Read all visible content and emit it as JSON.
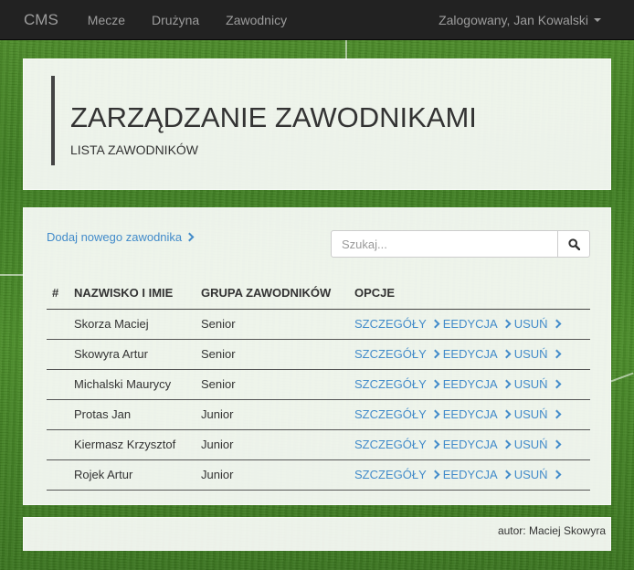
{
  "navbar": {
    "brand": "CMS",
    "links": [
      "Mecze",
      "Drużyna",
      "Zawodnicy"
    ],
    "user": "Zalogowany, Jan Kowalski"
  },
  "header": {
    "title": "ZARZĄDZANIE ZAWODNIKAMI",
    "subtitle": "LISTA ZAWODNIKÓW"
  },
  "content": {
    "add_link": "Dodaj nowego zawodnika",
    "search_placeholder": "Szukaj...",
    "columns": [
      "#",
      "NAZWISKO I IMIE",
      "GRUPA ZAWODNIKÓW",
      "OPCJE"
    ],
    "options": [
      "SZCZEGÓŁY",
      "EEDYCJA",
      "USUŃ"
    ],
    "rows": [
      {
        "name": "Skorza Maciej",
        "group": "Senior"
      },
      {
        "name": "Skowyra Artur",
        "group": "Senior"
      },
      {
        "name": "Michalski Maurycy",
        "group": "Senior"
      },
      {
        "name": "Protas Jan",
        "group": "Junior"
      },
      {
        "name": "Kiermasz Krzysztof",
        "group": "Junior"
      },
      {
        "name": "Rojek Artur",
        "group": "Junior"
      }
    ]
  },
  "footer": {
    "author": "autor: Maciej Skowyra"
  },
  "colors": {
    "link": "#428bca",
    "navbar": "#222222",
    "grass": "#4a8c28"
  }
}
